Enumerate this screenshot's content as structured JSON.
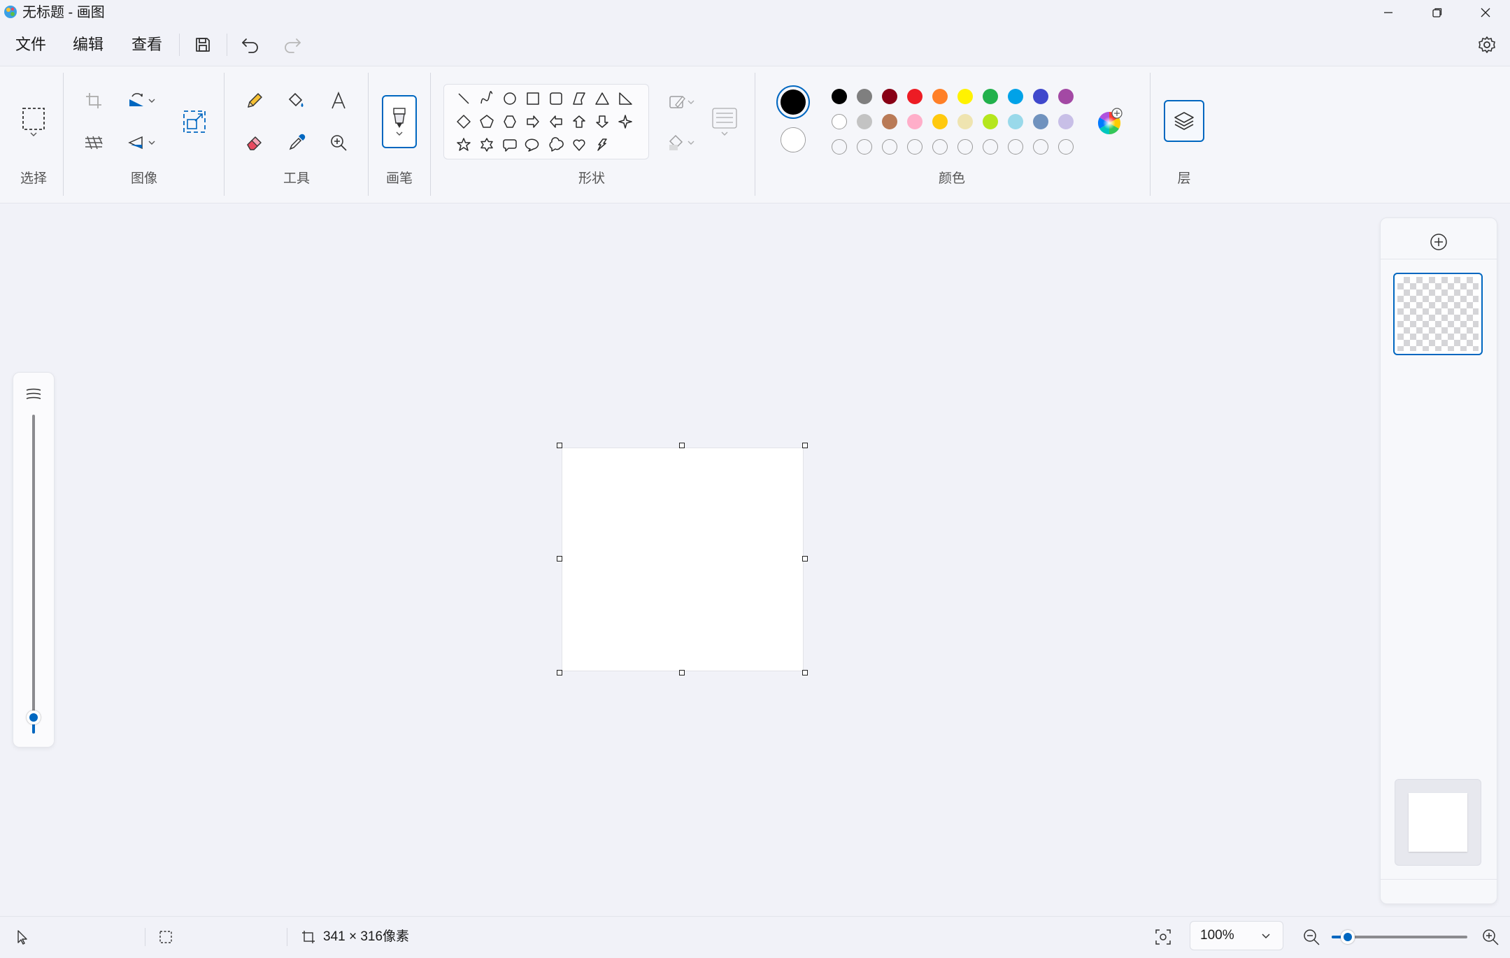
{
  "window": {
    "title": "无标题 - 画图"
  },
  "menu": {
    "file": "文件",
    "edit": "编辑",
    "view": "查看"
  },
  "ribbon": {
    "groups": {
      "select": "选择",
      "image": "图像",
      "tools": "工具",
      "brushes": "画笔",
      "shapes": "形状",
      "colors": "颜色",
      "layers": "层"
    },
    "primary_color": "#000000",
    "secondary_color": "#ffffff",
    "palette_row1": [
      "#000000",
      "#7f7f7f",
      "#880015",
      "#ed1c24",
      "#ff7f27",
      "#fff200",
      "#22b14c",
      "#00a2e8",
      "#3f48cc",
      "#a349a4"
    ],
    "palette_row2": [
      "#ffffff",
      "#c3c3c3",
      "#b97a57",
      "#ffaec9",
      "#ffc90e",
      "#efe4b0",
      "#b5e61d",
      "#99d9ea",
      "#7092be",
      "#c8bfe7"
    ],
    "palette_row3": [
      "empty",
      "empty",
      "empty",
      "empty",
      "empty",
      "empty",
      "empty",
      "empty",
      "empty",
      "empty"
    ],
    "shape_icons": [
      "line",
      "curve",
      "oval",
      "rectangle",
      "rounded-rectangle",
      "polygon",
      "triangle",
      "right-triangle",
      "diamond",
      "pentagon",
      "hexagon",
      "right-arrow",
      "left-arrow",
      "up-arrow",
      "down-arrow",
      "four-point-star",
      "five-point-star",
      "six-point-star",
      "rounded-callout",
      "oval-callout",
      "cloud-callout",
      "heart",
      "lightning"
    ]
  },
  "status": {
    "canvas_size": "341 × 316像素",
    "zoom": "100%",
    "zoom_level": 0.12
  },
  "brush_size_level": 0.05,
  "accent": "#0067c0"
}
